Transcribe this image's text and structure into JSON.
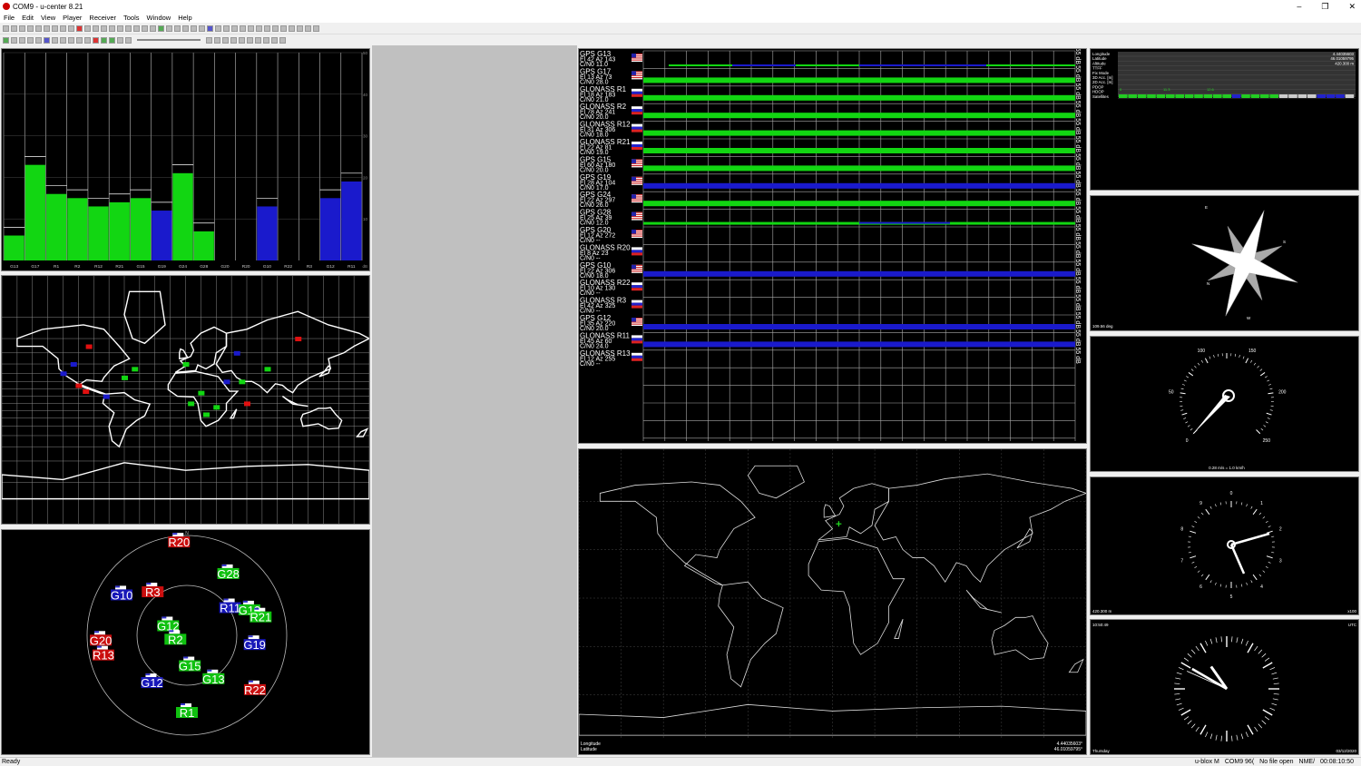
{
  "window": {
    "title": "COM9 - u-center 8.21",
    "minimize": "–",
    "restore": "❐",
    "close": "✕"
  },
  "menu": [
    "File",
    "Edit",
    "View",
    "Player",
    "Receiver",
    "Tools",
    "Window",
    "Help"
  ],
  "status": {
    "ready": "Ready",
    "receiver": "u-blox M",
    "port": "COM9 96(",
    "file": "No file open",
    "proto": "NME/",
    "time": "00:08:10:50"
  },
  "colors": {
    "used": "#12d612",
    "notused": "#1a1acc",
    "lost": "#ffffff",
    "red": "#e01010"
  },
  "cn0_chart": {
    "tick_labels": [
      "50",
      "40",
      "30",
      "20",
      "10"
    ],
    "sats": [
      "G13",
      "G17",
      "R1",
      "R2",
      "R12",
      "R21",
      "G15",
      "G19",
      "G24",
      "G28",
      "G20",
      "R20",
      "G10",
      "R22",
      "R3",
      "G12",
      "R11"
    ],
    "unit": "dB"
  },
  "chart_data": {
    "type": "bar",
    "categories": [
      "G13",
      "G17",
      "R1",
      "R2",
      "R12",
      "R21",
      "G15",
      "G19",
      "G24",
      "G28",
      "G20",
      "R20",
      "G10",
      "R22",
      "R3",
      "G12",
      "R11"
    ],
    "values": [
      6,
      23,
      16,
      15,
      13,
      14,
      15,
      12,
      21,
      7,
      0,
      0,
      13,
      0,
      0,
      15,
      19
    ],
    "states": [
      "used",
      "used",
      "used",
      "used",
      "used",
      "used",
      "used",
      "notused",
      "used",
      "used",
      "none",
      "none",
      "notused",
      "none",
      "none",
      "notused",
      "notused"
    ],
    "ylim": [
      0,
      50
    ]
  },
  "sky": {
    "north": "N",
    "sats": [
      {
        "id": "R20",
        "c": "red",
        "az": 355,
        "el": 8
      },
      {
        "id": "R3",
        "c": "red",
        "az": 320,
        "el": 42
      },
      {
        "id": "G10",
        "c": "blue",
        "az": 300,
        "el": 22
      },
      {
        "id": "G28",
        "c": "green",
        "az": 35,
        "el": 25
      },
      {
        "id": "R11",
        "c": "blue",
        "az": 60,
        "el": 45
      },
      {
        "id": "G12",
        "c": "green",
        "az": 290,
        "el": 72
      },
      {
        "id": "G13",
        "c": "green",
        "az": 70,
        "el": 30
      },
      {
        "id": "R21",
        "c": "green",
        "az": 78,
        "el": 22
      },
      {
        "id": "R2",
        "c": "green",
        "az": 240,
        "el": 78
      },
      {
        "id": "G19",
        "c": "blue",
        "az": 100,
        "el": 28
      },
      {
        "id": "G20",
        "c": "red",
        "az": 265,
        "el": 12
      },
      {
        "id": "R13",
        "c": "red",
        "az": 255,
        "el": 12
      },
      {
        "id": "G15",
        "c": "green",
        "az": 175,
        "el": 60
      },
      {
        "id": "G12",
        "c": "blue",
        "az": 215,
        "el": 35
      },
      {
        "id": "G13",
        "c": "green",
        "az": 150,
        "el": 42
      },
      {
        "id": "R22",
        "c": "red",
        "az": 130,
        "el": 10
      },
      {
        "id": "R1",
        "c": "green",
        "az": 180,
        "el": 18
      }
    ]
  },
  "satlevels": [
    {
      "name": "GPS G13",
      "l2": "El 42 Az 143",
      "l3": "C/N0 11.0",
      "flag": "us"
    },
    {
      "name": "GPS G17",
      "l2": "El 13 Az 73",
      "l3": "C/N0 28.0",
      "flag": "us"
    },
    {
      "name": "GLONASS R1",
      "l2": "El 18 Az 183",
      "l3": "C/N0 21.0",
      "flag": "ru"
    },
    {
      "name": "GLONASS R2",
      "l2": "El 78 Az 241",
      "l3": "C/N0 20.0",
      "flag": "ru"
    },
    {
      "name": "GLONASS R12",
      "l2": "El 31 Az 306",
      "l3": "C/N0 18.0",
      "flag": "ru"
    },
    {
      "name": "GLONASS R21",
      "l2": "El 22 Az 81",
      "l3": "C/N0 19.0",
      "flag": "ru"
    },
    {
      "name": "GPS G15",
      "l2": "El 60 Az 180",
      "l3": "C/N0 20.0",
      "flag": "us"
    },
    {
      "name": "GPS G19",
      "l2": "El 28 Az 104",
      "l3": "C/N0 17.0",
      "flag": "us"
    },
    {
      "name": "GPS G24",
      "l2": "El 22 Az 297",
      "l3": "C/N0 26.0",
      "flag": "us"
    },
    {
      "name": "GPS G28",
      "l2": "El 25 Az 39",
      "l3": "C/N0 12.0",
      "flag": "us"
    },
    {
      "name": "GPS G20",
      "l2": "El 12 Az 272",
      "l3": "C/N0 --",
      "flag": "us"
    },
    {
      "name": "GLONASS R20",
      "l2": "El 8 Az 23",
      "l3": "C/N0 --",
      "flag": "ru"
    },
    {
      "name": "GPS G10",
      "l2": "El 22 Az 306",
      "l3": "C/N0 18.0",
      "flag": "us"
    },
    {
      "name": "GLONASS R22",
      "l2": "El 10 Az 130",
      "l3": "C/N0 --",
      "flag": "ru"
    },
    {
      "name": "GLONASS R3",
      "l2": "El 42 Az 325",
      "l3": "C/N0 --",
      "flag": "ru"
    },
    {
      "name": "GPS G12",
      "l2": "El 35 Az 220",
      "l3": "C/N0 20.0",
      "flag": "us"
    },
    {
      "name": "GLONASS R11",
      "l2": "El 45 Az 60",
      "l3": "C/N0 24.0",
      "flag": "ru"
    },
    {
      "name": "GLONASS R13",
      "l2": "El 12 Az 255",
      "l3": "C/N0 --",
      "flag": "ru"
    }
  ],
  "satlevel_bars": [
    {
      "c": "mix"
    },
    {
      "c": "green"
    },
    {
      "c": "green"
    },
    {
      "c": "green"
    },
    {
      "c": "green"
    },
    {
      "c": "green"
    },
    {
      "c": "green"
    },
    {
      "c": "blue"
    },
    {
      "c": "green"
    },
    {
      "c": "mixg"
    },
    {
      "c": "none"
    },
    {
      "c": "none"
    },
    {
      "c": "blue"
    },
    {
      "c": "none"
    },
    {
      "c": "none"
    },
    {
      "c": "blue"
    },
    {
      "c": "blue"
    },
    {
      "c": "none"
    }
  ],
  "satlevel_unit": "55 dB",
  "mainmap": {
    "lon_label": "Longitude",
    "lat_label": "Latitude",
    "lon": "4.44035603°",
    "lat": "46.01059795°"
  },
  "datawin": {
    "rows": [
      {
        "k": "Longitude",
        "v": "4.44035603"
      },
      {
        "k": "Latitude",
        "v": "46.01059795"
      },
      {
        "k": "Altitude",
        "v": "420.300 m"
      },
      {
        "k": "TTFF",
        "v": ""
      },
      {
        "k": "Fix Mode",
        "v": ""
      },
      {
        "k": "3D Acc. [m]",
        "v": ""
      },
      {
        "k": "2D Acc. [m]",
        "v": ""
      },
      {
        "k": "PDOP",
        "v": ""
      },
      {
        "k": "HDOP",
        "v": ""
      },
      {
        "k": "Satellites",
        "v": ""
      }
    ],
    "pdop_scale": [
      "0",
      "11.3",
      "12.6"
    ]
  },
  "compass": {
    "heading": "109.56 deg",
    "n": "N",
    "e": "E",
    "s": "S",
    "w": "W"
  },
  "speedo": {
    "ticks": [
      "0",
      "50",
      "100",
      "150",
      "200",
      "250"
    ],
    "readout": "0.28 m/s = 1.0 km/h"
  },
  "altimeter": {
    "ticks": [
      "0",
      "1",
      "2",
      "3",
      "4",
      "5",
      "6",
      "7",
      "8",
      "9"
    ],
    "readout": "420.300 m",
    "scale": "x100"
  },
  "clock": {
    "time": "10:50:49",
    "tz": "UTC",
    "day": "Thursday",
    "date": "03/12/2020"
  }
}
